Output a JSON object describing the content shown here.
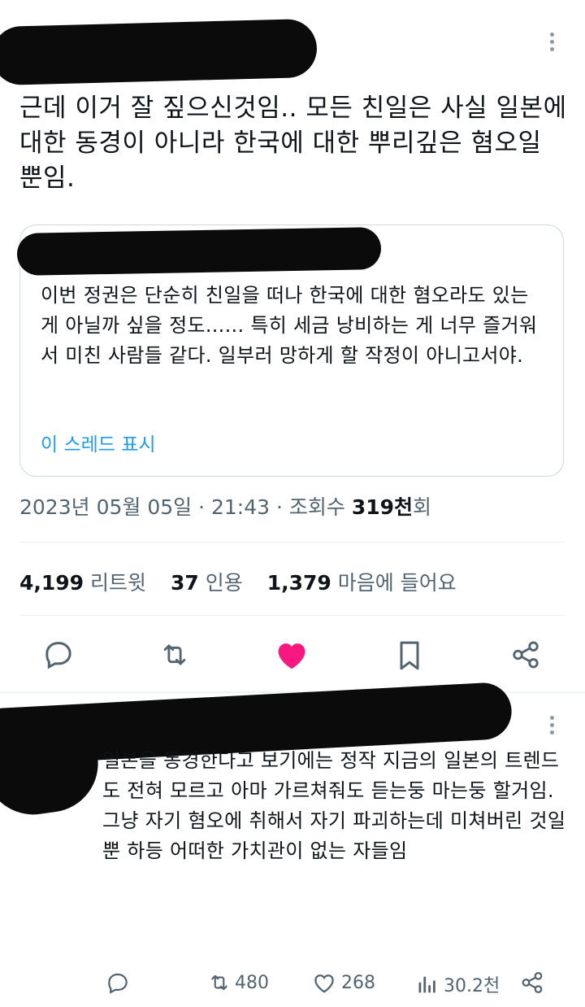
{
  "tweet": {
    "text": "근데 이거 잘 짚으신것임.. 모든 친일은 사실 일본에 대한 동경이 아니라 한국에 대한 뿌리깊은 혐오일 뿐임.",
    "quote": {
      "text": "이번 정권은 단순히 친일을 떠나 한국에 대한 혐오라도 있는 게 아닐까 싶을 정도...... 특히 세금 낭비하는 게 너무 즐거워서 미친 사람들 같다. 일부러 망하게 할 작정이 아니고서야.",
      "show_thread": "이 스레드 표시"
    },
    "meta": {
      "datetime": "2023년 05월 05일 · 21:43 · 조회수 ",
      "views": "319천",
      "views_suffix": "회"
    },
    "stats": {
      "retweets": "4,199",
      "retweets_label": "리트윗",
      "quotes": "37",
      "quotes_label": "인용",
      "likes": "1,379",
      "likes_label": "마음에 들어요"
    },
    "actions": {
      "reply_icon": "reply-icon",
      "retweet_icon": "retweet-icon",
      "like_icon": "heart-filled-icon",
      "bookmark_icon": "bookmark-icon",
      "share_icon": "share-icon"
    }
  },
  "reply": {
    "text_lines": [
      "일본을 동경한다고 보기에는 정작 지금의 일본의 트렌드도 전혀 모르고 아마 가르쳐줘도 듣는둥 마는둥 할거임.",
      "그냥 자기 혐오에 취해서 자기 파괴하는데 미쳐버린 것일뿐 하등 어떠한 가치관이 없는  자들임"
    ],
    "retweets": "480",
    "likes": "268",
    "views": "30.2천"
  },
  "colors": {
    "text": "#0f1419",
    "secondary": "#536471",
    "link": "#1d9bf0",
    "like": "#f91880",
    "border": "#cfd9de"
  }
}
